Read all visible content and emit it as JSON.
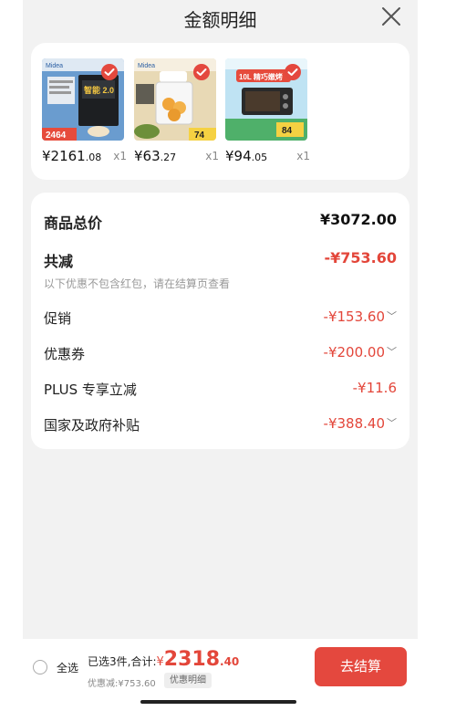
{
  "header": {
    "title": "金额明细"
  },
  "products": [
    {
      "price_int": "¥2161",
      "price_dec": ".08",
      "qty": "x1",
      "badge": "2464",
      "thumb_text": "智能 2.0"
    },
    {
      "price_int": "¥63",
      "price_dec": ".27",
      "qty": "x1",
      "badge": "74",
      "thumb_text": "Midea"
    },
    {
      "price_int": "¥94",
      "price_dec": ".05",
      "qty": "x1",
      "badge": "84",
      "thumb_text": "10L 精巧嫩烤"
    }
  ],
  "summary": {
    "total_label": "商品总价",
    "total_value": "¥3072.00",
    "reduce_label": "共减",
    "reduce_value": "-¥753.60",
    "note": "以下优惠不包含红包，请在结算页查看",
    "promo_label": "促销",
    "promo_value": "-¥153.60",
    "coupon_label": "优惠券",
    "coupon_value": "-¥200.00",
    "plus_label": "PLUS 专享立减",
    "plus_value": "-¥11.6",
    "subsidy_label": "国家及政府补贴",
    "subsidy_value": "-¥388.40"
  },
  "footer": {
    "select_all": "全选",
    "selected_text": "已选3件,合计:",
    "currency": "¥",
    "total_int": "2318",
    "total_dec": ".40",
    "discount_text": "优惠减:¥753.60",
    "detail_label": "优惠明细",
    "checkout_label": "去结算"
  },
  "colors": {
    "accent": "#e4483e",
    "price_red": "#e3463a",
    "background": "#f2f2f2"
  },
  "icons": {
    "close": "close-icon",
    "check": "check-icon",
    "expand": "chevron-down-icon",
    "radio": "radio-unchecked-icon"
  }
}
